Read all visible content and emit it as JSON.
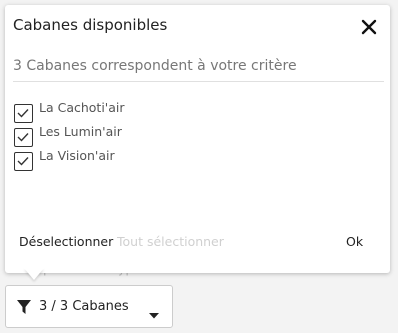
{
  "background": {
    "obscured_text": "vous pouvez les typer"
  },
  "popover": {
    "title": "Cabanes disponibles",
    "subtitle": "3 Cabanes correspondent à votre critère",
    "options": [
      {
        "label": "La Cachoti'air",
        "checked": true
      },
      {
        "label": "Les Lumin'air",
        "checked": true
      },
      {
        "label": "La Vision'air",
        "checked": true
      }
    ],
    "actions": {
      "deselect": "Déselectionner",
      "select_all": "Tout sélectionner",
      "ok": "Ok"
    }
  },
  "filter_button": {
    "label": "3 / 3 Cabanes",
    "icon": "filter-icon",
    "dropdown_icon": "caret-down-icon"
  },
  "colors": {
    "text": "#222222",
    "muted": "#777777",
    "disabled": "#d0d0d0",
    "border": "#cccccc"
  }
}
